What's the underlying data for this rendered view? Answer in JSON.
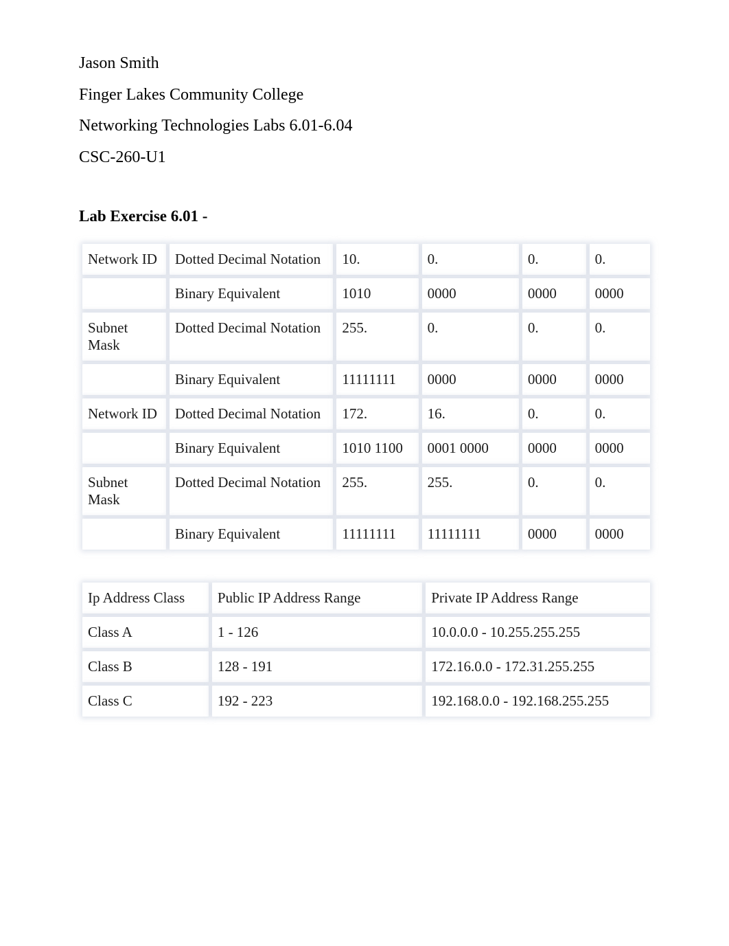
{
  "header": {
    "name": "Jason Smith",
    "school": "Finger Lakes Community College",
    "course_title": "Networking Technologies Labs 6.01-6.04",
    "course_code": "CSC-260-U1"
  },
  "lab": {
    "title": "Lab Exercise 6.01 -"
  },
  "table1": {
    "rows": [
      {
        "c0": "Network ID",
        "c1": "Dotted Decimal Notation",
        "c2": "10.",
        "c3": "0.",
        "c4": "0.",
        "c5": "0."
      },
      {
        "c0": "",
        "c1": "Binary Equivalent",
        "c2": "1010",
        "c3": "0000",
        "c4": "0000",
        "c5": "0000"
      },
      {
        "c0": "Subnet Mask",
        "c1": "Dotted Decimal Notation",
        "c2": "255.",
        "c3": "0.",
        "c4": "0.",
        "c5": "0."
      },
      {
        "c0": "",
        "c1": "Binary Equivalent",
        "c2": "11111111",
        "c3": "0000",
        "c4": "0000",
        "c5": "0000"
      },
      {
        "c0": "Network ID",
        "c1": "Dotted Decimal Notation",
        "c2": "172.",
        "c3": "16.",
        "c4": "0.",
        "c5": "0."
      },
      {
        "c0": "",
        "c1": "Binary Equivalent",
        "c2": "1010 1100",
        "c3": "0001 0000",
        "c4": "0000",
        "c5": "0000"
      },
      {
        "c0": "Subnet Mask",
        "c1": "Dotted Decimal Notation",
        "c2": "255.",
        "c3": "255.",
        "c4": "0.",
        "c5": "0."
      },
      {
        "c0": "",
        "c1": "Binary Equivalent",
        "c2": "11111111",
        "c3": "11111111",
        "c4": "0000",
        "c5": "0000"
      }
    ]
  },
  "table2": {
    "rows": [
      {
        "c0": "Ip Address Class",
        "c1": "Public IP Address Range",
        "c2": "Private IP Address Range"
      },
      {
        "c0": "Class A",
        "c1": "1 - 126",
        "c2": "10.0.0.0 - 10.255.255.255"
      },
      {
        "c0": "Class B",
        "c1": "128 - 191",
        "c2": "172.16.0.0 - 172.31.255.255"
      },
      {
        "c0": "Class C",
        "c1": "192 - 223",
        "c2": "192.168.0.0 - 192.168.255.255"
      }
    ]
  }
}
